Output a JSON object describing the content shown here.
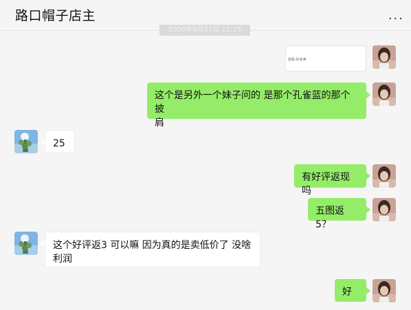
{
  "header": {
    "title": "路口帽子店主",
    "more_label": "..."
  },
  "timestamp": "2020年8月27日 21:25",
  "messages": [
    {
      "side": "me",
      "type": "image",
      "thumb_text": "皮肤-好多卖"
    },
    {
      "side": "me",
      "type": "text",
      "text_line1": "这个是另外一个妹子问的 是那个孔雀蓝的那个披",
      "text_line2": "肩"
    },
    {
      "side": "other",
      "type": "text",
      "text": "25"
    },
    {
      "side": "me",
      "type": "text",
      "text": "有好评返现吗"
    },
    {
      "side": "me",
      "type": "text",
      "text": "五图返5？"
    },
    {
      "side": "other",
      "type": "text",
      "text_line1": "这个好评返3 可以嘛  因为真的是卖低价了  没啥",
      "text_line2": "利润"
    },
    {
      "side": "me",
      "type": "text",
      "text": "好"
    }
  ],
  "avatars": {
    "me": "girl-portrait-avatar",
    "other": "tree-sky-avatar"
  },
  "colors": {
    "me_bubble": "#95ec69",
    "other_bubble": "#ffffff",
    "background": "#f5f5f5"
  }
}
